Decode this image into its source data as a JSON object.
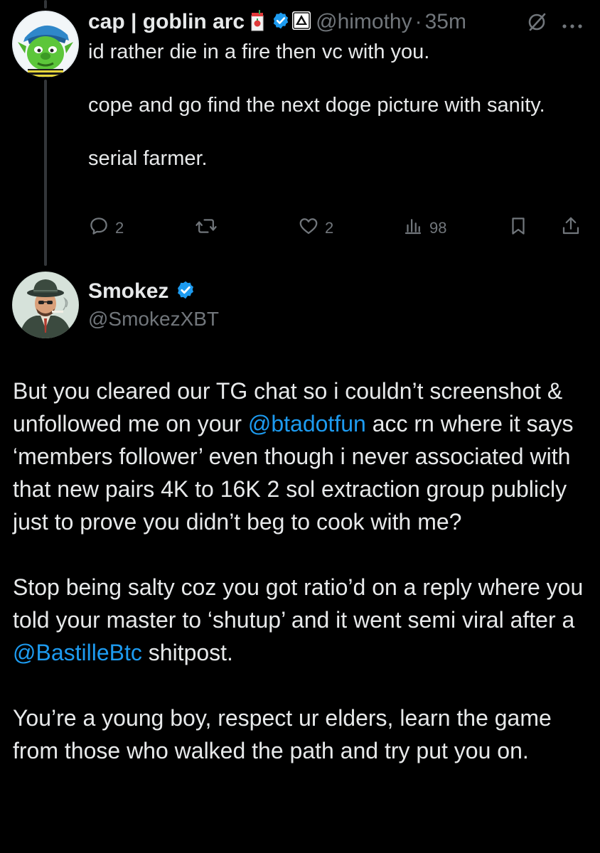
{
  "tweet1": {
    "display_name": "cap | goblin arc",
    "handle": "@himothy",
    "separator": "·",
    "time": "35m",
    "paragraphs": [
      "id rather die in a fire then vc with you.",
      "cope and go find the next doge picture with sanity.",
      "serial farmer."
    ],
    "stats": {
      "replies": "2",
      "likes": "2",
      "views": "98"
    },
    "icons": [
      "juice-box-emoji",
      "verified-badge",
      "affiliate-badge",
      "grok-icon",
      "more-icon",
      "reply-icon",
      "retweet-icon",
      "like-icon",
      "views-icon",
      "bookmark-icon",
      "share-icon"
    ]
  },
  "tweet2": {
    "display_name": "Smokez",
    "handle": "@SmokezXBT",
    "paragraphs": [
      {
        "before": "But you cleared our TG chat so i couldn’t screenshot & unfollowed me on your ",
        "mention": "@btadotfun",
        "after": " acc rn where it says ‘members follower’ even though i never associated with that new pairs 4K to 16K 2 sol extraction group publicly just to prove you didn’t beg to cook with me?"
      },
      {
        "before": "Stop being salty coz you got ratio’d on a reply where you told your master to ‘shutup’ and it went semi viral after a ",
        "mention": "@BastilleBtc",
        "after": " shitpost."
      },
      {
        "before": "You’re a young boy, respect ur elders, learn the game from those who walked the path and try put you on.",
        "mention": "",
        "after": ""
      }
    ]
  },
  "colors": {
    "background": "#000000",
    "text": "#e7e9ea",
    "muted": "#71767b",
    "link": "#1d9bf0",
    "verified": "#1d9bf0",
    "thread_line": "#333639"
  }
}
